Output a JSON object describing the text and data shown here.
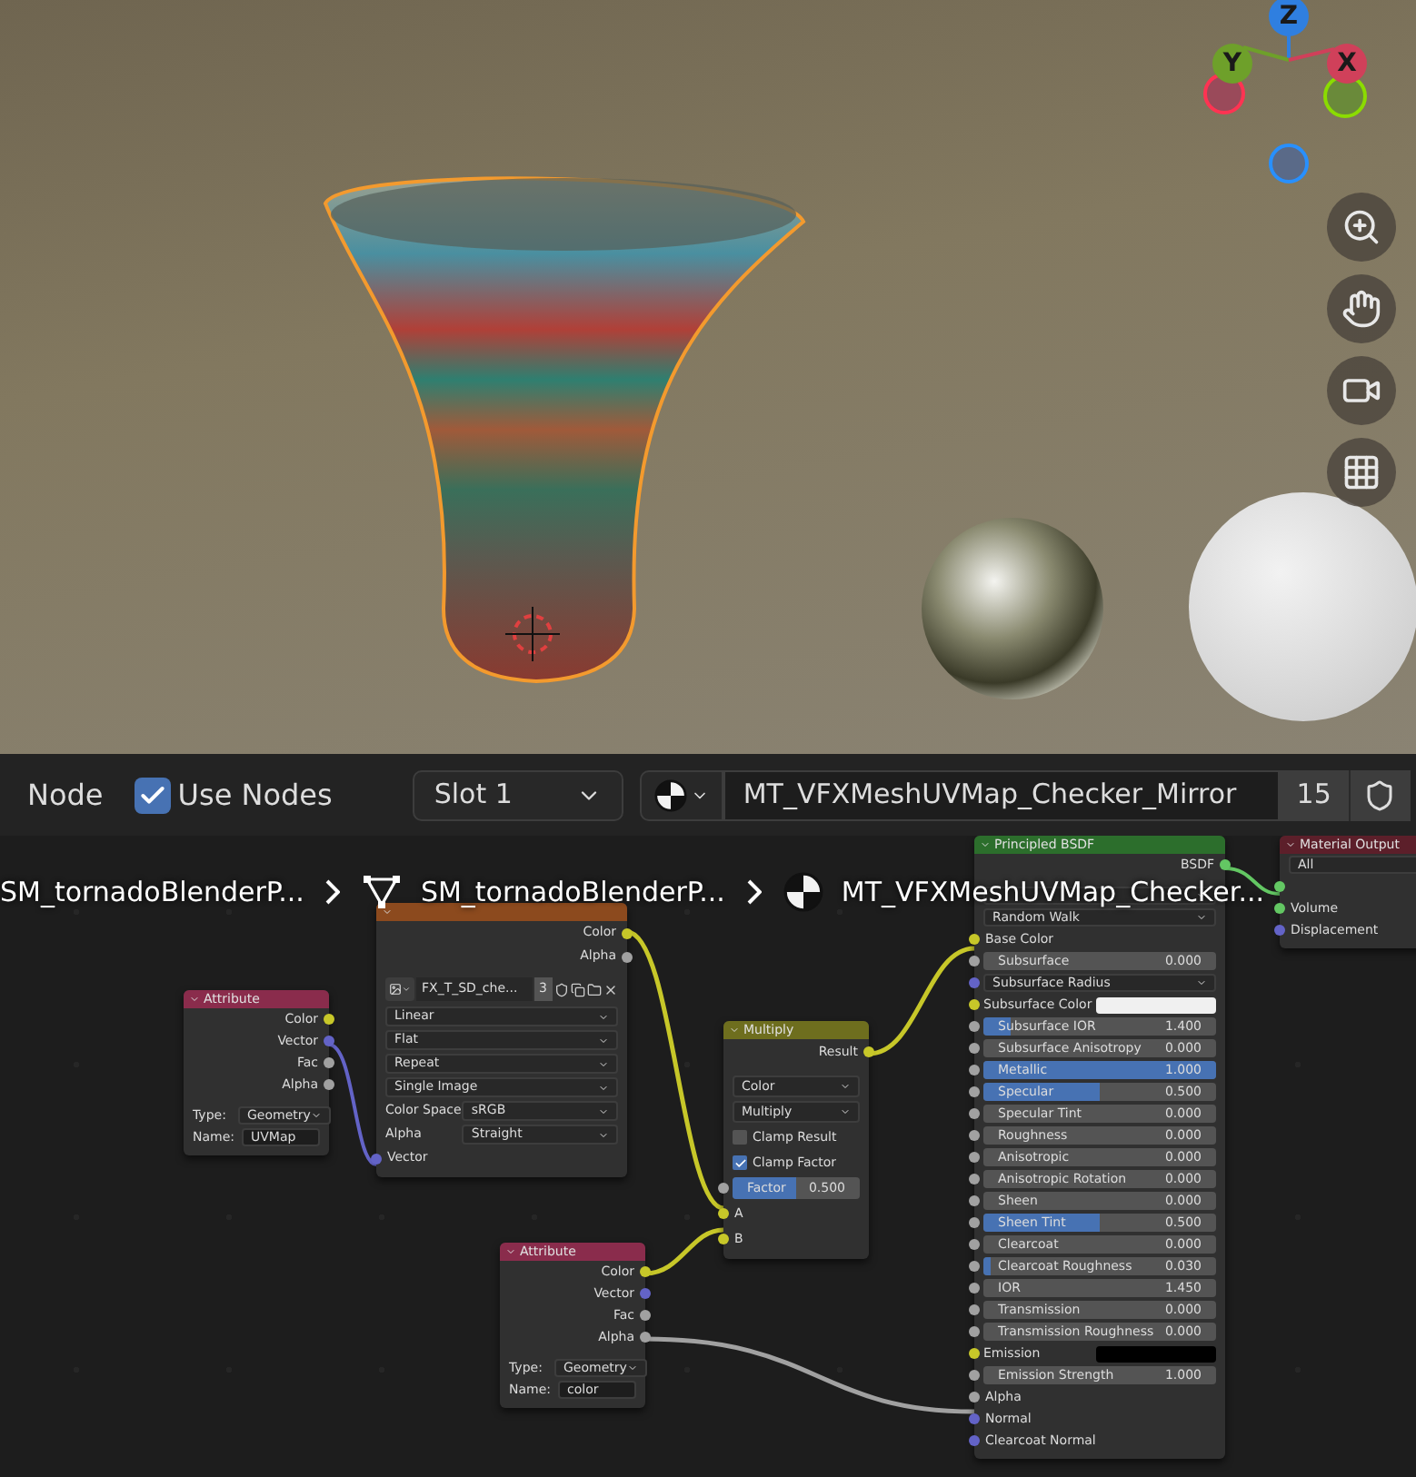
{
  "viewport": {
    "gizmo": [
      {
        "label": "Z",
        "color": "#2f7fe0"
      },
      {
        "label": "Y",
        "color": "#6ea02a"
      },
      {
        "label": "X",
        "color": "#d0405a"
      }
    ]
  },
  "header": {
    "editor_label": "Node",
    "use_nodes": {
      "label": "Use Nodes",
      "checked": true
    },
    "slot": "Slot 1",
    "material_name": "MT_VFXMeshUVMap_Checker_Mirror",
    "users": "15"
  },
  "breadcrumbs": [
    {
      "kind": "object",
      "label": "SM_tornadoBlenderP..."
    },
    {
      "kind": "mesh",
      "label": "SM_tornadoBlenderP..."
    },
    {
      "kind": "material",
      "label": "MT_VFXMeshUVMap_Checker..."
    }
  ],
  "nodes": [
    {
      "title": "Attribute",
      "color": "#8a2c4c",
      "rows": [
        {
          "kind": "output",
          "label": "Color",
          "color": "#c7c729"
        },
        {
          "kind": "output",
          "label": "Vector",
          "color": "#6363c7"
        },
        {
          "kind": "output",
          "label": "Fac",
          "color": "#a1a1a1"
        },
        {
          "kind": "output",
          "label": "Alpha",
          "color": "#a1a1a1"
        },
        {
          "kind": "dropdown",
          "label": "Type:",
          "value": "Geometry"
        },
        {
          "kind": "field",
          "label": "Name:",
          "value": "UVMap"
        }
      ]
    },
    {
      "color": "#8c4a1e",
      "rows": [
        {
          "kind": "output",
          "label": "Color",
          "color": "#c7c729"
        },
        {
          "kind": "output",
          "label": "Alpha",
          "color": "#a1a1a1"
        },
        {
          "kind": "image",
          "value": "FX_T_SD_che...",
          "users": "3"
        },
        {
          "kind": "dropdown",
          "value": "Linear"
        },
        {
          "kind": "dropdown",
          "value": "Flat"
        },
        {
          "kind": "dropdown",
          "value": "Repeat"
        },
        {
          "kind": "dropdown",
          "value": "Single Image"
        },
        {
          "kind": "dropdown",
          "label": "Color Space",
          "value": "sRGB"
        },
        {
          "kind": "dropdown",
          "label": "Alpha",
          "value": "Straight"
        },
        {
          "kind": "input",
          "label": "Vector",
          "color": "#6363c7"
        }
      ]
    },
    {
      "title": "Multiply",
      "color": "#6e6e1e",
      "rows": [
        {
          "kind": "output",
          "label": "Result",
          "color": "#c7c729"
        },
        {
          "kind": "dropdown",
          "value": "Color"
        },
        {
          "kind": "dropdown",
          "value": "Multiply"
        },
        {
          "kind": "checkbox",
          "label": "Clamp Result",
          "checked": false
        },
        {
          "kind": "checkbox",
          "label": "Clamp Factor",
          "checked": true
        },
        {
          "kind": "slider",
          "label": "Factor",
          "value": "0.500",
          "level": 0.5,
          "color": "#a1a1a1"
        },
        {
          "kind": "input",
          "label": "A",
          "color": "#c7c729"
        },
        {
          "kind": "input",
          "label": "B",
          "color": "#c7c729"
        }
      ]
    },
    {
      "title": "Attribute",
      "color": "#8a2c4c",
      "rows": [
        {
          "kind": "output",
          "label": "Color",
          "color": "#c7c729"
        },
        {
          "kind": "output",
          "label": "Vector",
          "color": "#6363c7"
        },
        {
          "kind": "output",
          "label": "Fac",
          "color": "#a1a1a1"
        },
        {
          "kind": "output",
          "label": "Alpha",
          "color": "#a1a1a1"
        },
        {
          "kind": "dropdown",
          "label": "Type:",
          "value": "Geometry"
        },
        {
          "kind": "field",
          "label": "Name:",
          "value": "color"
        }
      ]
    },
    {
      "title": "Principled BSDF",
      "color": "#2c6e2c",
      "rows": [
        {
          "kind": "output",
          "label": "BSDF",
          "color": "#63c763"
        },
        {
          "kind": "dropdown"
        },
        {
          "kind": "dropdown",
          "value": "Random Walk"
        },
        {
          "kind": "input",
          "label": "Base Color",
          "color": "#c7c729"
        },
        {
          "kind": "slider",
          "label": "Subsurface",
          "value": "0.000",
          "level": 0,
          "color": "#a1a1a1"
        },
        {
          "kind": "dropdown",
          "value": "Subsurface Radius",
          "color": "#6363c7"
        },
        {
          "kind": "swatch",
          "label": "Subsurface Color",
          "color": "#f0f0f0"
        },
        {
          "kind": "slider",
          "label": "Subsurface IOR",
          "value": "1.400",
          "level": 0.12,
          "color": "#a1a1a1"
        },
        {
          "kind": "slider",
          "label": "Subsurface Anisotropy",
          "value": "0.000",
          "level": 0,
          "color": "#a1a1a1"
        },
        {
          "kind": "slider",
          "label": "Metallic",
          "value": "1.000",
          "level": 1,
          "color": "#a1a1a1"
        },
        {
          "kind": "slider",
          "label": "Specular",
          "value": "0.500",
          "level": 0.5,
          "color": "#a1a1a1"
        },
        {
          "kind": "slider",
          "label": "Specular Tint",
          "value": "0.000",
          "level": 0,
          "color": "#a1a1a1"
        },
        {
          "kind": "slider",
          "label": "Roughness",
          "value": "0.000",
          "level": 0,
          "color": "#a1a1a1"
        },
        {
          "kind": "slider",
          "label": "Anisotropic",
          "value": "0.000",
          "level": 0,
          "color": "#a1a1a1"
        },
        {
          "kind": "slider",
          "label": "Anisotropic Rotation",
          "value": "0.000",
          "level": 0,
          "color": "#a1a1a1"
        },
        {
          "kind": "slider",
          "label": "Sheen",
          "value": "0.000",
          "level": 0,
          "color": "#a1a1a1"
        },
        {
          "kind": "slider",
          "label": "Sheen Tint",
          "value": "0.500",
          "level": 0.5,
          "color": "#a1a1a1"
        },
        {
          "kind": "slider",
          "label": "Clearcoat",
          "value": "0.000",
          "level": 0,
          "color": "#a1a1a1"
        },
        {
          "kind": "slider",
          "label": "Clearcoat Roughness",
          "value": "0.030",
          "level": 0.03,
          "color": "#a1a1a1"
        },
        {
          "kind": "slider",
          "label": "IOR",
          "value": "1.450",
          "level": 0,
          "color": "#a1a1a1"
        },
        {
          "kind": "slider",
          "label": "Transmission",
          "value": "0.000",
          "level": 0,
          "color": "#a1a1a1"
        },
        {
          "kind": "slider",
          "label": "Transmission Roughness",
          "value": "0.000",
          "level": 0,
          "color": "#a1a1a1"
        },
        {
          "kind": "swatch",
          "label": "Emission",
          "color": "#000000"
        },
        {
          "kind": "slider",
          "label": "Emission Strength",
          "value": "1.000",
          "level": 0,
          "color": "#a1a1a1"
        },
        {
          "kind": "input",
          "label": "Alpha",
          "color": "#a1a1a1"
        },
        {
          "kind": "input",
          "label": "Normal",
          "color": "#6363c7"
        },
        {
          "kind": "input",
          "label": "Clearcoat Normal",
          "color": "#6363c7"
        }
      ]
    },
    {
      "title": "Material Output",
      "color": "#5c1f2a",
      "rows": [
        {
          "kind": "dropdown",
          "value": "All"
        },
        {
          "kind": "input",
          "color": "#63c763"
        },
        {
          "kind": "input",
          "label": "Volume",
          "color": "#63c763"
        },
        {
          "kind": "input",
          "label": "Displacement",
          "color": "#6363c7"
        }
      ]
    }
  ]
}
